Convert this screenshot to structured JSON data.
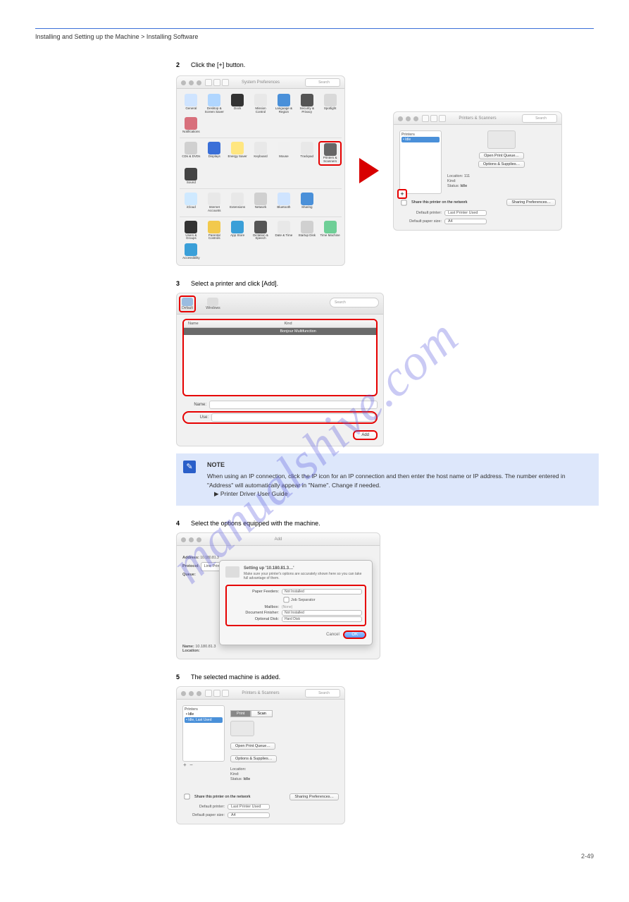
{
  "watermark": "manualshive.com",
  "header": {
    "breadcrumb": "Installing and Setting up the Machine > Installing Software"
  },
  "page_num": "2-49",
  "steps": [
    {
      "num": "2",
      "text": "Click the [+] button."
    },
    {
      "num": "3",
      "text": "Select a printer and click [Add]."
    },
    {
      "num": "4",
      "text": "Select the options equipped with the machine."
    },
    {
      "num": "5",
      "text": "The selected machine is added."
    }
  ],
  "fig1": {
    "sysprefs": {
      "title": "System Preferences",
      "search": "Search",
      "rows": [
        [
          {
            "label": "General",
            "bg": "#cfe4ff"
          },
          {
            "label": "Desktop & Screen Saver",
            "bg": "#b0d6ff"
          },
          {
            "label": "Dock",
            "bg": "#333"
          },
          {
            "label": "Mission Control",
            "bg": "#e8e8e8"
          },
          {
            "label": "Language & Region",
            "bg": "#4a90d9"
          },
          {
            "label": "Security & Privacy",
            "bg": "#555"
          },
          {
            "label": "Spotlight",
            "bg": "#d9d9d9"
          },
          {
            "label": "Notifications",
            "bg": "#d8707c"
          }
        ],
        [
          {
            "label": "CDs & DVDs",
            "bg": "#d0d0d0"
          },
          {
            "label": "Displays",
            "bg": "#3a6fd8"
          },
          {
            "label": "Energy Saver",
            "bg": "#ffe680"
          },
          {
            "label": "Keyboard",
            "bg": "#e8e8e8"
          },
          {
            "label": "Mouse",
            "bg": "#f0f0f0"
          },
          {
            "label": "Trackpad",
            "bg": "#e8e8e8"
          },
          {
            "label": "Printers & Scanners",
            "bg": "#666",
            "hl": true
          },
          {
            "label": "Sound",
            "bg": "#444"
          }
        ],
        [
          {
            "label": "iCloud",
            "bg": "#cfe9ff"
          },
          {
            "label": "Internet Accounts",
            "bg": "#e8e8e8"
          },
          {
            "label": "Extensions",
            "bg": "#e8e8e8"
          },
          {
            "label": "Network",
            "bg": "#d0d0d0"
          },
          {
            "label": "Bluetooth",
            "bg": "#cfe4ff"
          },
          {
            "label": "Sharing",
            "bg": "#4a90d9"
          }
        ],
        [
          {
            "label": "Users & Groups",
            "bg": "#333"
          },
          {
            "label": "Parental Controls",
            "bg": "#f2c94c"
          },
          {
            "label": "App Store",
            "bg": "#3a9fd8"
          },
          {
            "label": "Dictation & Speech",
            "bg": "#555"
          },
          {
            "label": "Date & Time",
            "bg": "#e8e8e8"
          },
          {
            "label": "Startup Disk",
            "bg": "#d0d0d0"
          },
          {
            "label": "Time Machine",
            "bg": "#6fcf97"
          },
          {
            "label": "Accessibility",
            "bg": "#3a9fd8"
          }
        ]
      ]
    },
    "printers": {
      "title": "Printers & Scanners",
      "search": "Search",
      "list_header": "Printers",
      "list_item": "• Idle",
      "btn_queue": "Open Print Queue…",
      "btn_options": "Options & Supplies…",
      "loc_label": "Location:",
      "loc_val": "111",
      "kind_label": "Kind:",
      "status_label": "Status:",
      "status_val": "Idle",
      "share_label": "Share this printer on the network",
      "btn_sharing": "Sharing Preferences…",
      "default_label": "Default printer:",
      "default_val": "Last Printer Used",
      "paper_label": "Default paper size:",
      "paper_val": "A4"
    }
  },
  "fig3": {
    "tab_default": "Default",
    "tab_ip": "Windows",
    "search": "Search",
    "col_name": "Name",
    "col_kind": "Kind",
    "row_name": "",
    "row_kind": "Bonjour Multifunction",
    "name_label": "Name:",
    "use_label": "Use:",
    "add_btn": "Add"
  },
  "note": {
    "title": "NOTE",
    "line1": "When using an IP connection, click the IP icon for an IP connection and then enter the host name or IP address. The number entered in \"Address\" will automatically appear in \"Name\". Change if needed.",
    "link": "Printer Driver User Guide"
  },
  "fig5": {
    "title": "Add",
    "addr_label": "Address:",
    "addr_val": "10.180.81.3",
    "proto_label": "Protocol:",
    "proto_val": "Line Printer Daemon - LPD",
    "queue_label": "Queue:",
    "sheet_title": "Setting up '10.180.81.3…'",
    "sheet_sub": "Make sure your printer's options are accurately shown here so you can take full advantage of them.",
    "opts": [
      {
        "label": "Paper Feeders:",
        "val": "Not Installed"
      },
      {
        "label": "Job Separator",
        "val": ""
      },
      {
        "label": "Mailbox:",
        "val": "(None)"
      },
      {
        "label": "Document Finisher:",
        "val": "Not Installed"
      },
      {
        "label": "Optional Disk:",
        "val": "Hard Disk"
      }
    ],
    "cancel": "Cancel",
    "ok": "OK",
    "name_label": "Name:",
    "name_val": "10.180.81.3",
    "loc_label": "Location:"
  },
  "fig6": {
    "title": "Printers & Scanners",
    "search": "Search",
    "list_header": "Printers",
    "item1": "• Idle",
    "item2": "• Idle, Last Used",
    "tab_print": "Print",
    "tab_scan": "Scan",
    "btn_queue": "Open Print Queue…",
    "btn_options": "Options & Supplies…",
    "loc_label": "Location:",
    "kind_label": "Kind:",
    "status_label": "Status:",
    "status_val": "Idle",
    "share_label": "Share this printer on the network",
    "btn_sharing": "Sharing Preferences…",
    "default_label": "Default printer:",
    "default_val": "Last Printer Used",
    "paper_label": "Default paper size:",
    "paper_val": "A4"
  }
}
